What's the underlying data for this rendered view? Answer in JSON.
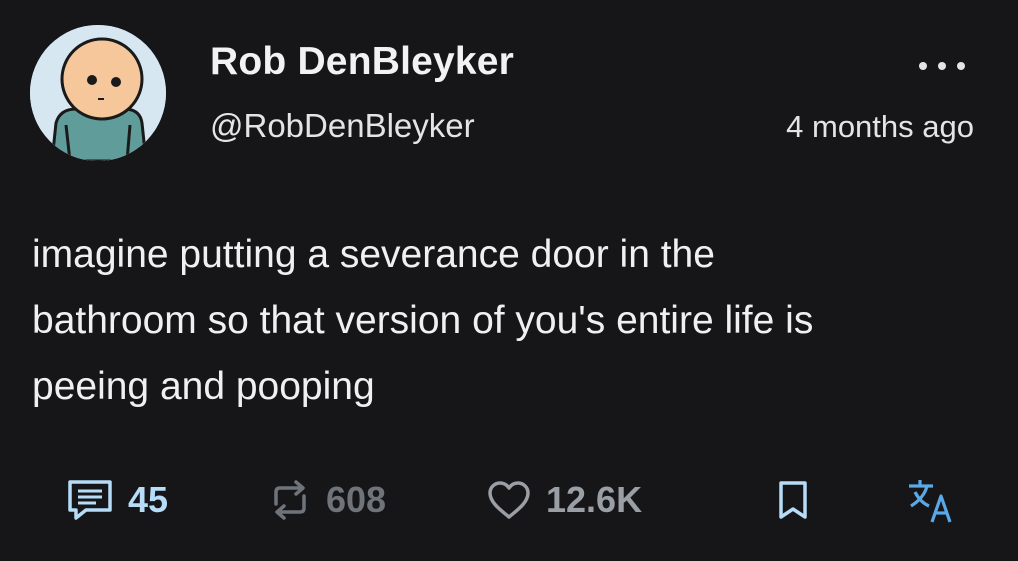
{
  "author": {
    "display_name": "Rob DenBleyker",
    "handle": "@RobDenBleyker"
  },
  "timestamp": "4 months ago",
  "post": {
    "text_lines": [
      "imagine putting a severance door in the",
      "bathroom so that version of you's entire life is",
      "peeing and pooping"
    ]
  },
  "actions": {
    "replies": "45",
    "reposts": "608",
    "likes": "12.6K"
  },
  "icons": {
    "more": "more-dots-icon",
    "reply": "reply-icon",
    "repost": "repost-icon",
    "like": "heart-icon",
    "bookmark": "bookmark-icon",
    "translate": "translate-icon"
  },
  "colors": {
    "background": "#161618",
    "text": "#f0f0f2",
    "accent": "#b6dcf7",
    "muted": "#6f737a"
  }
}
